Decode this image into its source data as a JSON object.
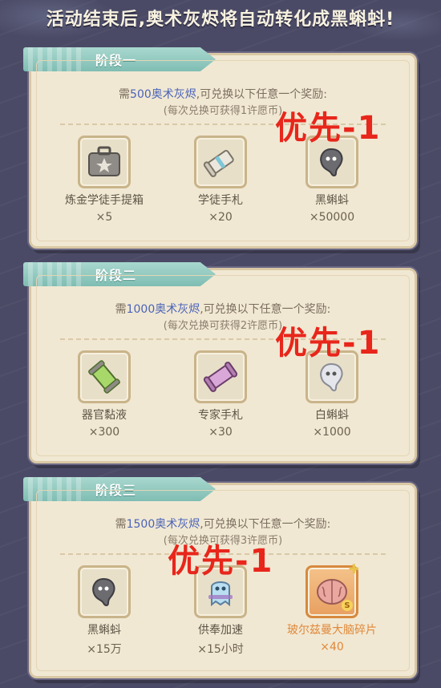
{
  "banner": {
    "text": "活动结束后,奥术灰烬将自动转化成黑蝌蚪!"
  },
  "stages": [
    {
      "title": "阶段一",
      "req_prefix": "需",
      "req_amount": "500奥术灰烬",
      "req_suffix": ",可兑换以下任意一个奖励:",
      "note": "(每次兑换可获得1许愿币)",
      "overlay": "优先-1",
      "rewards": [
        {
          "name": "炼金学徒手提箱",
          "qty": "×5",
          "icon": "briefcase-icon"
        },
        {
          "name": "学徒手札",
          "qty": "×20",
          "icon": "scroll-icon"
        },
        {
          "name": "黑蝌蚪",
          "qty": "×50000",
          "icon": "black-tadpole-icon"
        }
      ]
    },
    {
      "title": "阶段二",
      "req_prefix": "需",
      "req_amount": "1000奥术灰烬",
      "req_suffix": ",可兑换以下任意一个奖励:",
      "note": "(每次兑换可获得2许愿币)",
      "overlay": "优先-1",
      "rewards": [
        {
          "name": "器官黏液",
          "qty": "×300",
          "icon": "slime-tube-icon"
        },
        {
          "name": "专家手札",
          "qty": "×30",
          "icon": "expert-scroll-icon"
        },
        {
          "name": "白蝌蚪",
          "qty": "×1000",
          "icon": "white-tadpole-icon"
        }
      ]
    },
    {
      "title": "阶段三",
      "req_prefix": "需",
      "req_amount": "1500奥术灰烬",
      "req_suffix": ",可兑换以下任意一个奖励:",
      "note": "(每次兑换可获得3许愿币)",
      "overlay": "优先-1",
      "rewards": [
        {
          "name": "黑蝌蚪",
          "qty": "×15万",
          "icon": "black-tadpole-icon"
        },
        {
          "name": "供奉加速",
          "qty": "×15小时",
          "icon": "ghost-icon"
        },
        {
          "name": "玻尔兹曼大脑碎片",
          "qty": "×40",
          "icon": "brain-icon",
          "highlight": true
        }
      ]
    }
  ],
  "colors": {
    "background": "#4b4a66",
    "panel": "#f1e8d3",
    "tab": "#7fbdb3",
    "amount": "#4a63b8",
    "overlay_red": "#e8261b",
    "highlight_orange": "#e0893a"
  }
}
